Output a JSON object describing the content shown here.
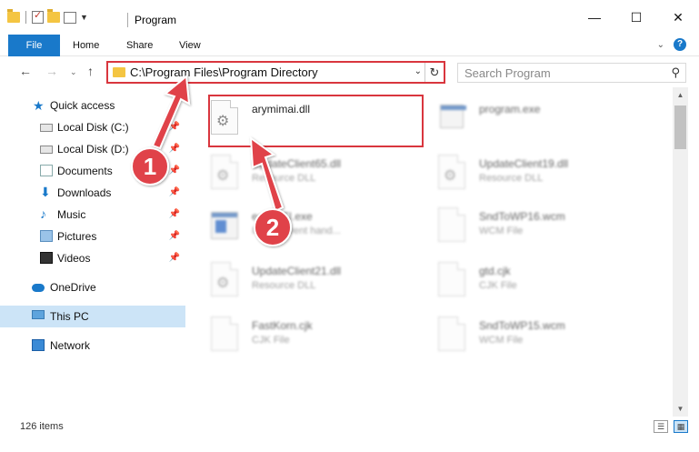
{
  "window": {
    "title": "Program",
    "controls": {
      "minimize": "—",
      "maximize": "☐",
      "close": "✕"
    }
  },
  "ribbon": {
    "tabs": {
      "file": "File",
      "home": "Home",
      "share": "Share",
      "view": "View"
    },
    "help": "?",
    "expand": "⌄"
  },
  "address": {
    "path": "C:\\Program Files\\Program Directory",
    "dropdown": "⌄",
    "refresh": "↻"
  },
  "search": {
    "placeholder": "Search Program",
    "icon": "⚲"
  },
  "nav": {
    "back": "←",
    "forward": "→",
    "recent": "⌄",
    "up": "↑"
  },
  "sidebar": {
    "items": [
      {
        "label": "Quick access",
        "icon": "star-icon"
      },
      {
        "label": "Local Disk (C:)",
        "icon": "drive-icon"
      },
      {
        "label": "Local Disk (D:)",
        "icon": "drive-icon"
      },
      {
        "label": "Documents",
        "icon": "documents-icon"
      },
      {
        "label": "Downloads",
        "icon": "download-icon"
      },
      {
        "label": "Music",
        "icon": "music-icon"
      },
      {
        "label": "Pictures",
        "icon": "pictures-icon"
      },
      {
        "label": "Videos",
        "icon": "videos-icon"
      },
      {
        "label": "OneDrive",
        "icon": "cloud-icon"
      },
      {
        "label": "This PC",
        "icon": "computer-icon"
      },
      {
        "label": "Network",
        "icon": "network-icon"
      }
    ],
    "pin": "📌"
  },
  "files": [
    {
      "name": "arymimai.dll",
      "type": ""
    },
    {
      "name": "program.exe",
      "type": ""
    },
    {
      "name": "UpdateClient65.dll",
      "type": "Resource DLL"
    },
    {
      "name": "UpdateClient19.dll",
      "type": "Resource DLL"
    },
    {
      "name": "easySTI.exe",
      "type": "Import event hand..."
    },
    {
      "name": "SndToWP16.wcm",
      "type": "WCM File"
    },
    {
      "name": "UpdateClient21.dll",
      "type": "Resource DLL"
    },
    {
      "name": "gtd.cjk",
      "type": "CJK File"
    },
    {
      "name": "FastKorn.cjk",
      "type": "CJK File"
    },
    {
      "name": "SndToWP15.wcm",
      "type": "WCM File"
    }
  ],
  "annotations": {
    "step1": "1",
    "step2": "2",
    "color": "#d9363e"
  },
  "status": {
    "count": "126 items"
  },
  "colors": {
    "accent": "#1979ca",
    "highlight": "#d9363e",
    "selected": "#cce4f7"
  }
}
